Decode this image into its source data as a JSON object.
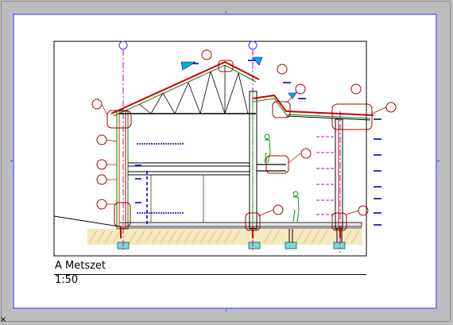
{
  "window": {
    "title": ""
  },
  "sheet": {
    "border_color": "#8080ff",
    "background": "#ffffff"
  },
  "section": {
    "name": "A Metszet",
    "scale": "1:50"
  },
  "colors": {
    "gridline": "#c000c0",
    "structure_red": "#cc0000",
    "structure_green": "#00a000",
    "dimension_blue": "#0000cc",
    "callout_red": "#aa0000",
    "ground_hatch": "#c8b060",
    "footing_cyan": "#00b0b0"
  },
  "icons": {
    "corner": "cursor-x-icon"
  },
  "corner_glyph": "×"
}
